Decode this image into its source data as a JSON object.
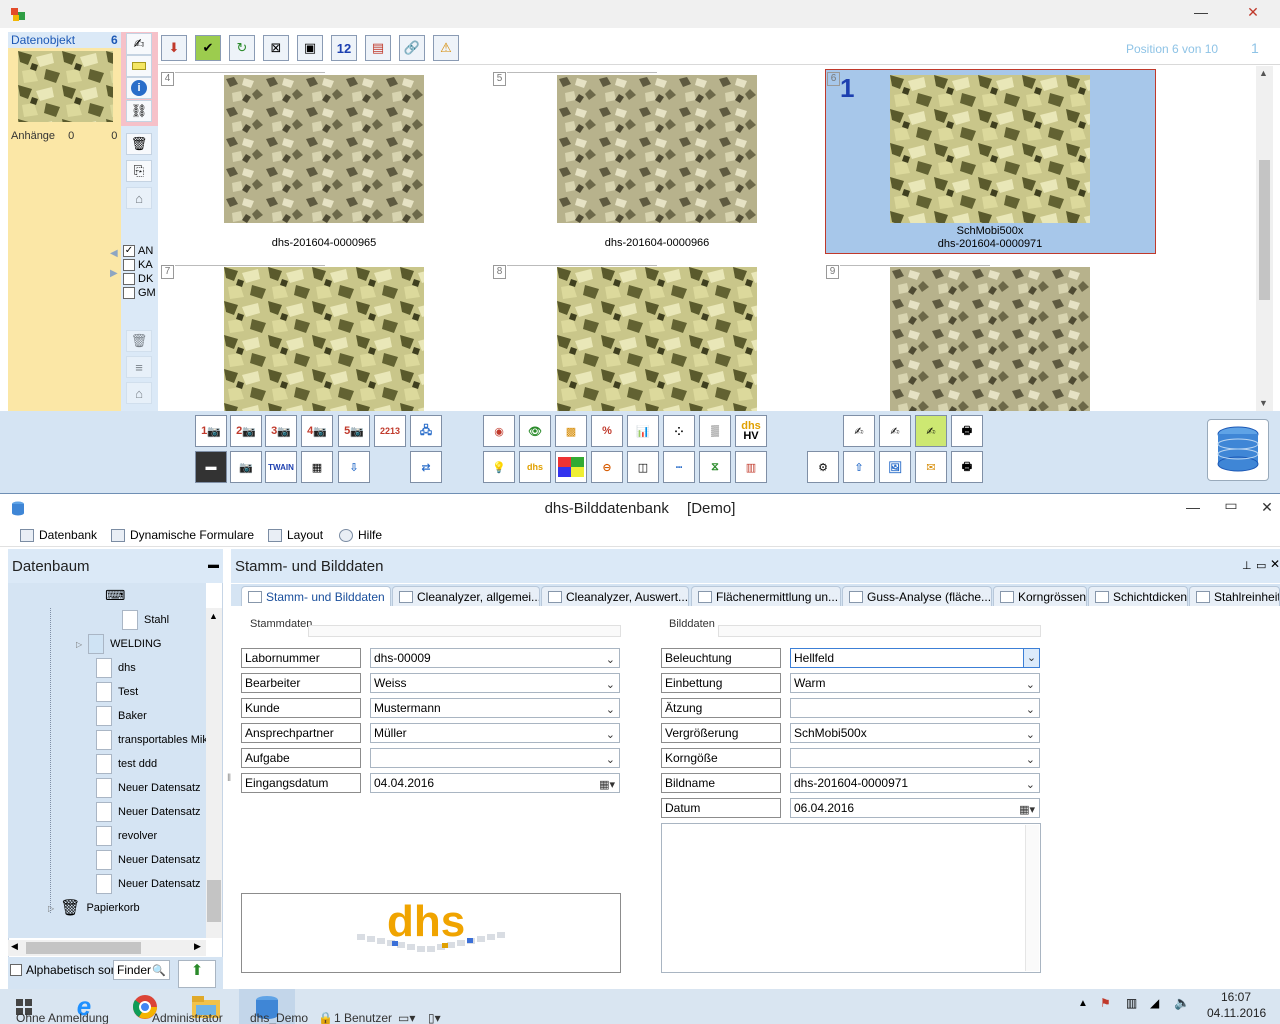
{
  "viewer": {
    "object_title": "Datenobjekt",
    "object_count": "6",
    "attachments_label": "Anhänge",
    "attachments_count_a": "0",
    "attachments_count_b": "0",
    "filters": [
      {
        "label": "AN",
        "checked": true
      },
      {
        "label": "KA",
        "checked": false
      },
      {
        "label": "DK",
        "checked": false
      },
      {
        "label": "GM",
        "checked": false
      }
    ],
    "position_label": "Position 6 von 10",
    "position_page": "1",
    "page_glyph": "12",
    "cells": [
      {
        "num": "4",
        "caption_1": "",
        "caption_2": "dhs-201604-0000965",
        "selected": false
      },
      {
        "num": "5",
        "caption_1": "",
        "caption_2": "dhs-201604-0000966",
        "selected": false
      },
      {
        "num": "6",
        "caption_1": "SchMobi500x",
        "caption_2": "dhs-201604-0000971",
        "selected": true,
        "big_num": "1"
      },
      {
        "num": "7",
        "caption_1": "",
        "caption_2": "",
        "selected": false
      },
      {
        "num": "8",
        "caption_1": "",
        "caption_2": "",
        "selected": false
      },
      {
        "num": "9",
        "caption_1": "",
        "caption_2": "",
        "selected": false
      }
    ],
    "camera_labels": [
      "1",
      "2",
      "3",
      "4",
      "5",
      "2213"
    ],
    "twain_label": "TWAIN",
    "percent_label": "%",
    "dhs_label": "dhs",
    "hv_label": "HV"
  },
  "main": {
    "title": "dhs-Bilddatenbank",
    "title_suffix": "[Demo]",
    "menu": [
      "Datenbank",
      "Dynamische Formulare",
      "Layout",
      "Hilfe"
    ],
    "tree_title": "Datenbaum",
    "tree_items": [
      "Stahl",
      "WELDING",
      "dhs",
      "Test",
      "Baker",
      "transportables Mik",
      "test ddd",
      "Neuer Datensatz",
      "Neuer Datensatz",
      "revolver",
      "Neuer Datensatz",
      "Neuer Datensatz",
      "Papierkorb"
    ],
    "tree_footer_label": "Alphabetisch sor",
    "tree_footer_finder": "Finder",
    "content_title": "Stamm- und Bilddaten",
    "tabs": [
      "Stamm- und Bilddaten",
      "Cleanalyzer, allgemei...",
      "Cleanalyzer, Auswert...",
      "Flächenermittlung un...",
      "Guss-Analyse (fläche...",
      "Korngrössen",
      "Schichtdicken",
      "Stahlreinheit"
    ],
    "stamm_group": "Stammdaten",
    "bild_group": "Bilddaten",
    "stamm_fields": [
      {
        "label": "Labornummer",
        "value": "dhs-00009"
      },
      {
        "label": "Bearbeiter",
        "value": "Weiss"
      },
      {
        "label": "Kunde",
        "value": "Mustermann"
      },
      {
        "label": "Ansprechpartner",
        "value": "Müller"
      },
      {
        "label": "Aufgabe",
        "value": ""
      },
      {
        "label": "Eingangsdatum",
        "value": "04.04.2016"
      }
    ],
    "bild_fields": [
      {
        "label": "Beleuchtung",
        "value": "Hellfeld"
      },
      {
        "label": "Einbettung",
        "value": "Warm"
      },
      {
        "label": "Ätzung",
        "value": ""
      },
      {
        "label": "Vergrößerung",
        "value": "SchMobi500x"
      },
      {
        "label": "Korngöße",
        "value": ""
      },
      {
        "label": "Bildname",
        "value": "dhs-201604-0000971"
      },
      {
        "label": "Datum",
        "value": "06.04.2016"
      }
    ],
    "logo_text": "dhs"
  },
  "taskbar": {
    "status_login": "Ohne Anmeldung",
    "status_user": "Administrator",
    "status_db": "dhs_Demo",
    "status_users": "1 Benutzer",
    "time": "16:07",
    "date": "04.11.2016"
  },
  "colors": {
    "accent_blue": "#1c58b5",
    "selection": "#a7c7ea",
    "panel_yellow": "#fbe7a6",
    "panel_blue": "#d5e4f3",
    "position_text": "#8ec3e6"
  }
}
